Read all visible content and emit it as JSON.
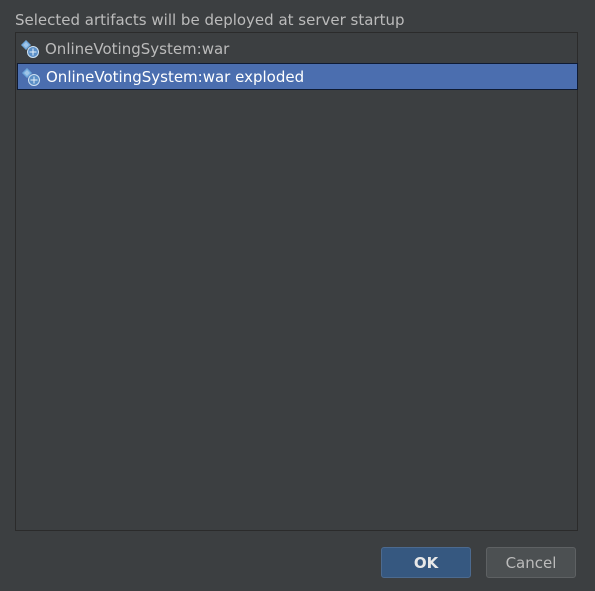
{
  "dialog": {
    "header_text": "Selected artifacts will be deployed at server startup"
  },
  "artifacts": {
    "items": [
      {
        "label": "OnlineVotingSystem:war",
        "icon": "artifact-war-icon",
        "selected": false
      },
      {
        "label": "OnlineVotingSystem:war exploded",
        "icon": "artifact-war-exploded-icon",
        "selected": true
      }
    ]
  },
  "buttons": {
    "ok_label": "OK",
    "cancel_label": "Cancel"
  },
  "colors": {
    "background": "#3c3f41",
    "selection": "#4b6eaf",
    "ok_button": "#365880",
    "cancel_button": "#4c5052",
    "text": "#bbbbbb"
  }
}
